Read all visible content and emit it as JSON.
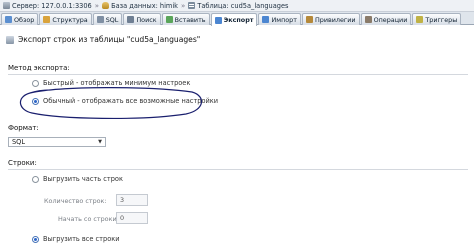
{
  "breadcrumb": {
    "server": "Сервер: 127.0.0.1:3306",
    "database": "База данных: himik",
    "table": "Таблица: cud5a_languages",
    "separator": "»"
  },
  "tabs": [
    {
      "label": "Обзор",
      "icon": "browse-icon",
      "color": "#5b8fd0"
    },
    {
      "label": "Структура",
      "icon": "structure-icon",
      "color": "#d9a33b"
    },
    {
      "label": "SQL",
      "icon": "sql-icon",
      "color": "#7f8fa3"
    },
    {
      "label": "Поиск",
      "icon": "search-icon",
      "color": "#6f7f93"
    },
    {
      "label": "Вставить",
      "icon": "insert-icon",
      "color": "#5aa55a"
    },
    {
      "label": "Экспорт",
      "icon": "export-icon",
      "color": "#4c86d1",
      "active": true
    },
    {
      "label": "Импорт",
      "icon": "import-icon",
      "color": "#4c86d1"
    },
    {
      "label": "Привилегии",
      "icon": "privileges-icon",
      "color": "#b5893a"
    },
    {
      "label": "Операции",
      "icon": "operations-icon",
      "color": "#8a7b6a"
    },
    {
      "label": "Триггеры",
      "icon": "triggers-icon",
      "color": "#c0b245"
    }
  ],
  "page_title": "Экспорт строк из таблицы \"cud5a_languages\"",
  "export_method": {
    "label": "Метод экспорта:",
    "options": [
      {
        "label": "Быстрый - отображать минимум настроек",
        "checked": false
      },
      {
        "label": "Обычный - отображать все возможные настройки",
        "checked": true
      }
    ]
  },
  "format": {
    "label": "Формат:",
    "value": "SQL"
  },
  "rows": {
    "label": "Строки:",
    "option_some": "Выгрузить часть строк",
    "count_label": "Количество строк:",
    "count_value": "3",
    "start_label": "Начать со строки:",
    "start_value": "0",
    "option_all": "Выгрузить все строки",
    "some_checked": false,
    "all_checked": true
  },
  "annotation_color": "#1a1f6e"
}
